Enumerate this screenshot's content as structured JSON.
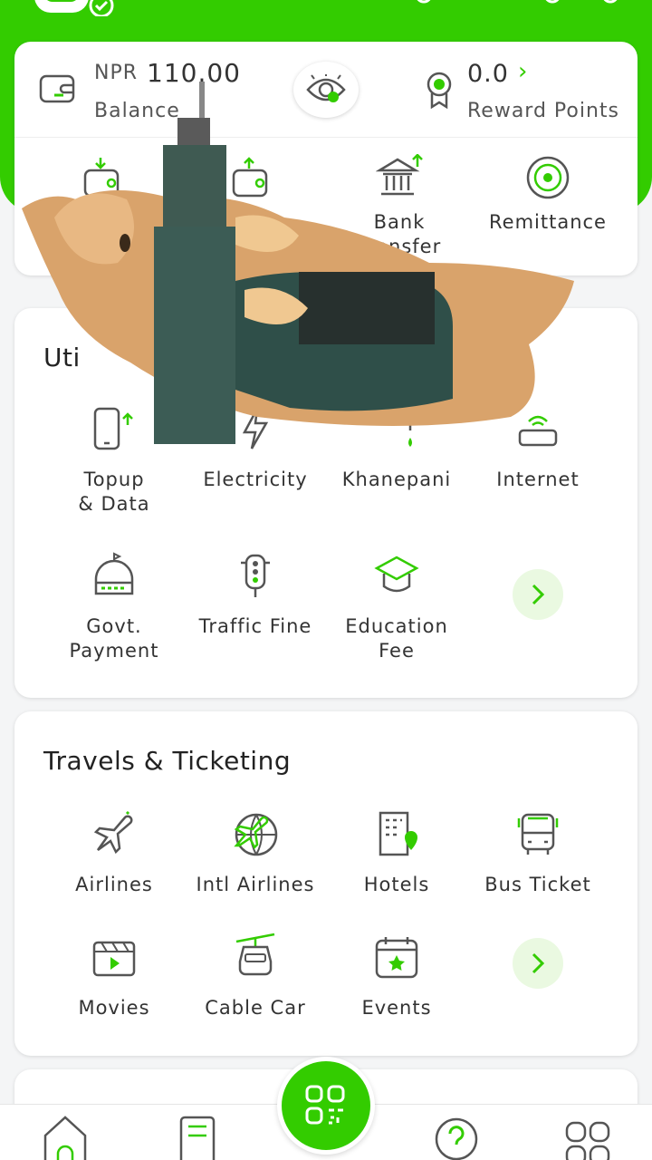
{
  "colors": {
    "brand": "#33cc00",
    "brand_light": "#eaf9e1",
    "text": "#333333"
  },
  "balance": {
    "currency": "NPR",
    "amount": "110.00",
    "label": "Balance",
    "reward_value": "0.0",
    "reward_label": "Reward Points"
  },
  "quick_actions": [
    {
      "label": "",
      "icon": "wallet-download-icon"
    },
    {
      "label": "",
      "icon": "wallet-upload-icon"
    },
    {
      "label": "Bank\nTransfer",
      "icon": "bank-transfer-icon"
    },
    {
      "label": "Remittance",
      "icon": "remittance-icon"
    }
  ],
  "utilities": {
    "title": "Uti",
    "items": [
      {
        "label": "Topup\n& Data",
        "icon": "phone-topup-icon"
      },
      {
        "label": "Electricity",
        "icon": "electricity-icon"
      },
      {
        "label": "Khanepani",
        "icon": "water-tap-icon"
      },
      {
        "label": "Internet",
        "icon": "internet-router-icon"
      },
      {
        "label": "Govt.\nPayment",
        "icon": "government-building-icon"
      },
      {
        "label": "Traffic Fine",
        "icon": "traffic-light-icon"
      },
      {
        "label": "Education\nFee",
        "icon": "graduation-cap-icon"
      }
    ]
  },
  "travels": {
    "title": "Travels & Ticketing",
    "items": [
      {
        "label": "Airlines",
        "icon": "airplane-icon"
      },
      {
        "label": "Intl Airlines",
        "icon": "globe-airplane-icon"
      },
      {
        "label": "Hotels",
        "icon": "hotel-icon"
      },
      {
        "label": "Bus Ticket",
        "icon": "bus-icon"
      },
      {
        "label": "Movies",
        "icon": "movie-clapper-icon"
      },
      {
        "label": "Cable Car",
        "icon": "cable-car-icon"
      },
      {
        "label": "Events",
        "icon": "calendar-star-icon"
      }
    ]
  },
  "overlay": {
    "description_icon": "cat-with-drill-sticker"
  },
  "bottom_nav": [
    {
      "icon": "home-icon"
    },
    {
      "icon": "statement-icon"
    },
    {
      "icon": "qr-scan-icon"
    },
    {
      "icon": "help-icon"
    },
    {
      "icon": "more-apps-icon"
    }
  ]
}
